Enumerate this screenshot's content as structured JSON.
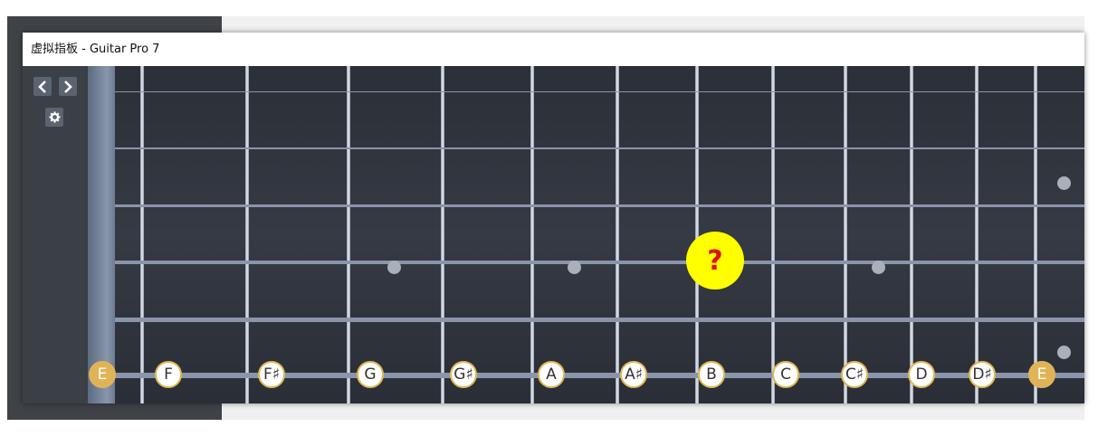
{
  "window": {
    "title": "虚拟指板 - Guitar Pro 7"
  },
  "toolbar": {
    "prev_icon": "chevron-left-icon",
    "next_icon": "chevron-right-icon",
    "settings_icon": "gear-icon"
  },
  "fretboard": {
    "notes": [
      {
        "label": "E",
        "root": true
      },
      {
        "label": "F",
        "root": false
      },
      {
        "label": "F♯",
        "root": false
      },
      {
        "label": "G",
        "root": false
      },
      {
        "label": "G♯",
        "root": false
      },
      {
        "label": "A",
        "root": false
      },
      {
        "label": "A♯",
        "root": false
      },
      {
        "label": "B",
        "root": false
      },
      {
        "label": "C",
        "root": false
      },
      {
        "label": "C♯",
        "root": false
      },
      {
        "label": "D",
        "root": false
      },
      {
        "label": "D♯",
        "root": false
      },
      {
        "label": "E",
        "root": true
      }
    ],
    "inlay_positions": [
      "fret 3",
      "fret 5",
      "fret 7",
      "fret 9",
      "fret 12"
    ],
    "highlight_marker": "?"
  },
  "colors": {
    "board": "#2f3339",
    "fret_wire": "#d9dde3",
    "string": "#8a95ab",
    "note_border": "#e2b755",
    "root_note": "#e0b456",
    "marker_fill": "#ffff00",
    "marker_text": "#e01010"
  }
}
